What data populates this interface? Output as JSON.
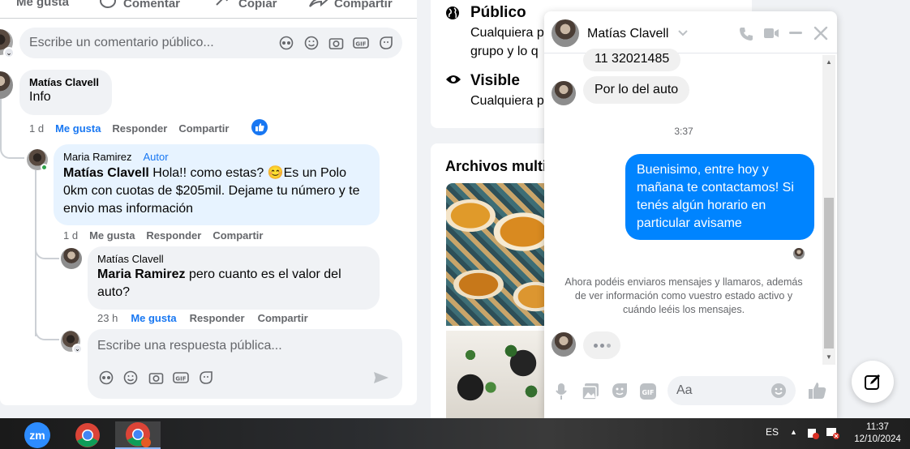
{
  "post_actions": {
    "like": "Me gusta",
    "comment": "Comentar",
    "copy": "Copiar",
    "share": "Compartir"
  },
  "comment_box": {
    "placeholder": "Escribe un comentario público..."
  },
  "comments": [
    {
      "author": "Matías Clavell",
      "text": "Info",
      "time": "1 d",
      "like": "Me gusta",
      "reply": "Responder",
      "share": "Compartir"
    }
  ],
  "replies": [
    {
      "author": "Maria Ramirez",
      "badge": "Autor",
      "mention": "Matías Clavell",
      "text_1": " Hola!! como estas? ",
      "emoji": "😊",
      "text_2": "Es un Polo 0km con cuotas de $205mil. Dejame tu número y te envio mas información",
      "time": "1 d",
      "like": "Me gusta",
      "reply": "Responder",
      "share": "Compartir"
    },
    {
      "author": "Matías Clavell",
      "mention": "Maria Ramirez",
      "text": " pero cuanto es el valor del auto?",
      "time": "23 h",
      "like": "Me gusta",
      "reply": "Responder",
      "share": "Compartir"
    }
  ],
  "reply_box": {
    "placeholder": "Escribe una respuesta pública..."
  },
  "audience": {
    "public_title": "Público",
    "public_desc_1": "Cualquiera p",
    "public_desc_2": "grupo y lo q",
    "visible_title": "Visible",
    "visible_desc": "Cualquiera p"
  },
  "media": {
    "title": "Archivos multi"
  },
  "chat": {
    "contact": "Matías Clavell",
    "messages_in": [
      "11 32021485",
      "Por lo del auto"
    ],
    "timestamp": "3:37",
    "message_out": "Buenisimo, entre hoy y mañana te contactamos! Si tenés algún horario en particular avisame",
    "notice": "Ahora podéis enviaros mensajes y llamaros, además de ver información como vuestro estado activo y cuándo leéis los mensajes.",
    "input_placeholder": "Aa"
  },
  "taskbar": {
    "lang": "ES",
    "time": "11:37",
    "date": "12/10/2024",
    "zoom_label": "zm"
  },
  "colors": {
    "accent": "#1877f2",
    "messenger_blue": "#0084ff"
  }
}
